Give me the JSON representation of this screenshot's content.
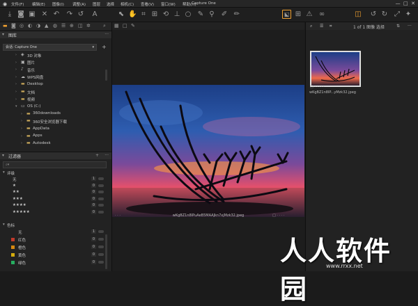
{
  "menubar": {
    "items": [
      "文件(F)",
      "编辑(E)",
      "图像(I)",
      "调整(A)",
      "图层",
      "选择",
      "相机(C)",
      "查看(V)",
      "窗口(W)",
      "帮助(H)"
    ],
    "title": "Capture One"
  },
  "library": {
    "title": "图库",
    "catalog": "会话: Capture One",
    "tree": [
      {
        "label": "3D 对象",
        "depth": 1,
        "icon": "cube-icon"
      },
      {
        "label": "图片",
        "depth": 1,
        "icon": "picture-icon"
      },
      {
        "label": "音乐",
        "depth": 1,
        "icon": "music-icon"
      },
      {
        "label": "WPS网盘",
        "depth": 1,
        "icon": "cloud-icon"
      },
      {
        "label": "Desktop",
        "depth": 1,
        "icon": "folder-icon"
      },
      {
        "label": "文档",
        "depth": 1,
        "icon": "folder-icon"
      },
      {
        "label": "视频",
        "depth": 1,
        "icon": "folder-icon"
      },
      {
        "label": "OS (C:)",
        "depth": 1,
        "icon": "drive-icon",
        "open": true
      },
      {
        "label": "360downloads",
        "depth": 2,
        "icon": "folder-icon"
      },
      {
        "label": "360安全浏览器下载",
        "depth": 2,
        "icon": "folder-icon"
      },
      {
        "label": "AppData",
        "depth": 2,
        "icon": "folder-icon"
      },
      {
        "label": "Apps",
        "depth": 2,
        "icon": "folder-icon"
      },
      {
        "label": "Autodesk",
        "depth": 2,
        "icon": "folder-icon"
      }
    ]
  },
  "filters": {
    "title": "过滤器",
    "search_placeholder": "",
    "rating_title": "评级",
    "ratings": [
      {
        "label": "无",
        "count": "1"
      },
      {
        "label": "★",
        "count": "0"
      },
      {
        "label": "★★",
        "count": "0"
      },
      {
        "label": "★★★",
        "count": "0"
      },
      {
        "label": "★★★★",
        "count": "0"
      },
      {
        "label": "★★★★★",
        "count": "0"
      }
    ],
    "color_title": "色标",
    "colors": [
      {
        "label": "无",
        "count": "1",
        "color": ""
      },
      {
        "label": "红色",
        "count": "0",
        "color": "#c0392b"
      },
      {
        "label": "橙色",
        "count": "0",
        "color": "#d68910"
      },
      {
        "label": "黄色",
        "count": "0",
        "color": "#d4ac0d"
      },
      {
        "label": "绿色",
        "count": "0",
        "color": "#27ae60"
      }
    ]
  },
  "viewer": {
    "caption": "wKgBZ1n8IPuAeB5MAAJkn7xjMzk32.jpeg",
    "left_dots": "· · ·",
    "right_dots": "□ · · · ·"
  },
  "browser": {
    "page_info": "1 of 1 图像 选择",
    "thumb_caption": "wKgBZ1n8IP...yMzk32.jpeg",
    "thumb_dots": "□ · · · · ·"
  },
  "watermark": {
    "text": "人人软件园",
    "url": "www.rrxx.net"
  },
  "colors": {
    "accent": "#f0a030",
    "panel": "#222222",
    "header": "#2d2d2d"
  }
}
